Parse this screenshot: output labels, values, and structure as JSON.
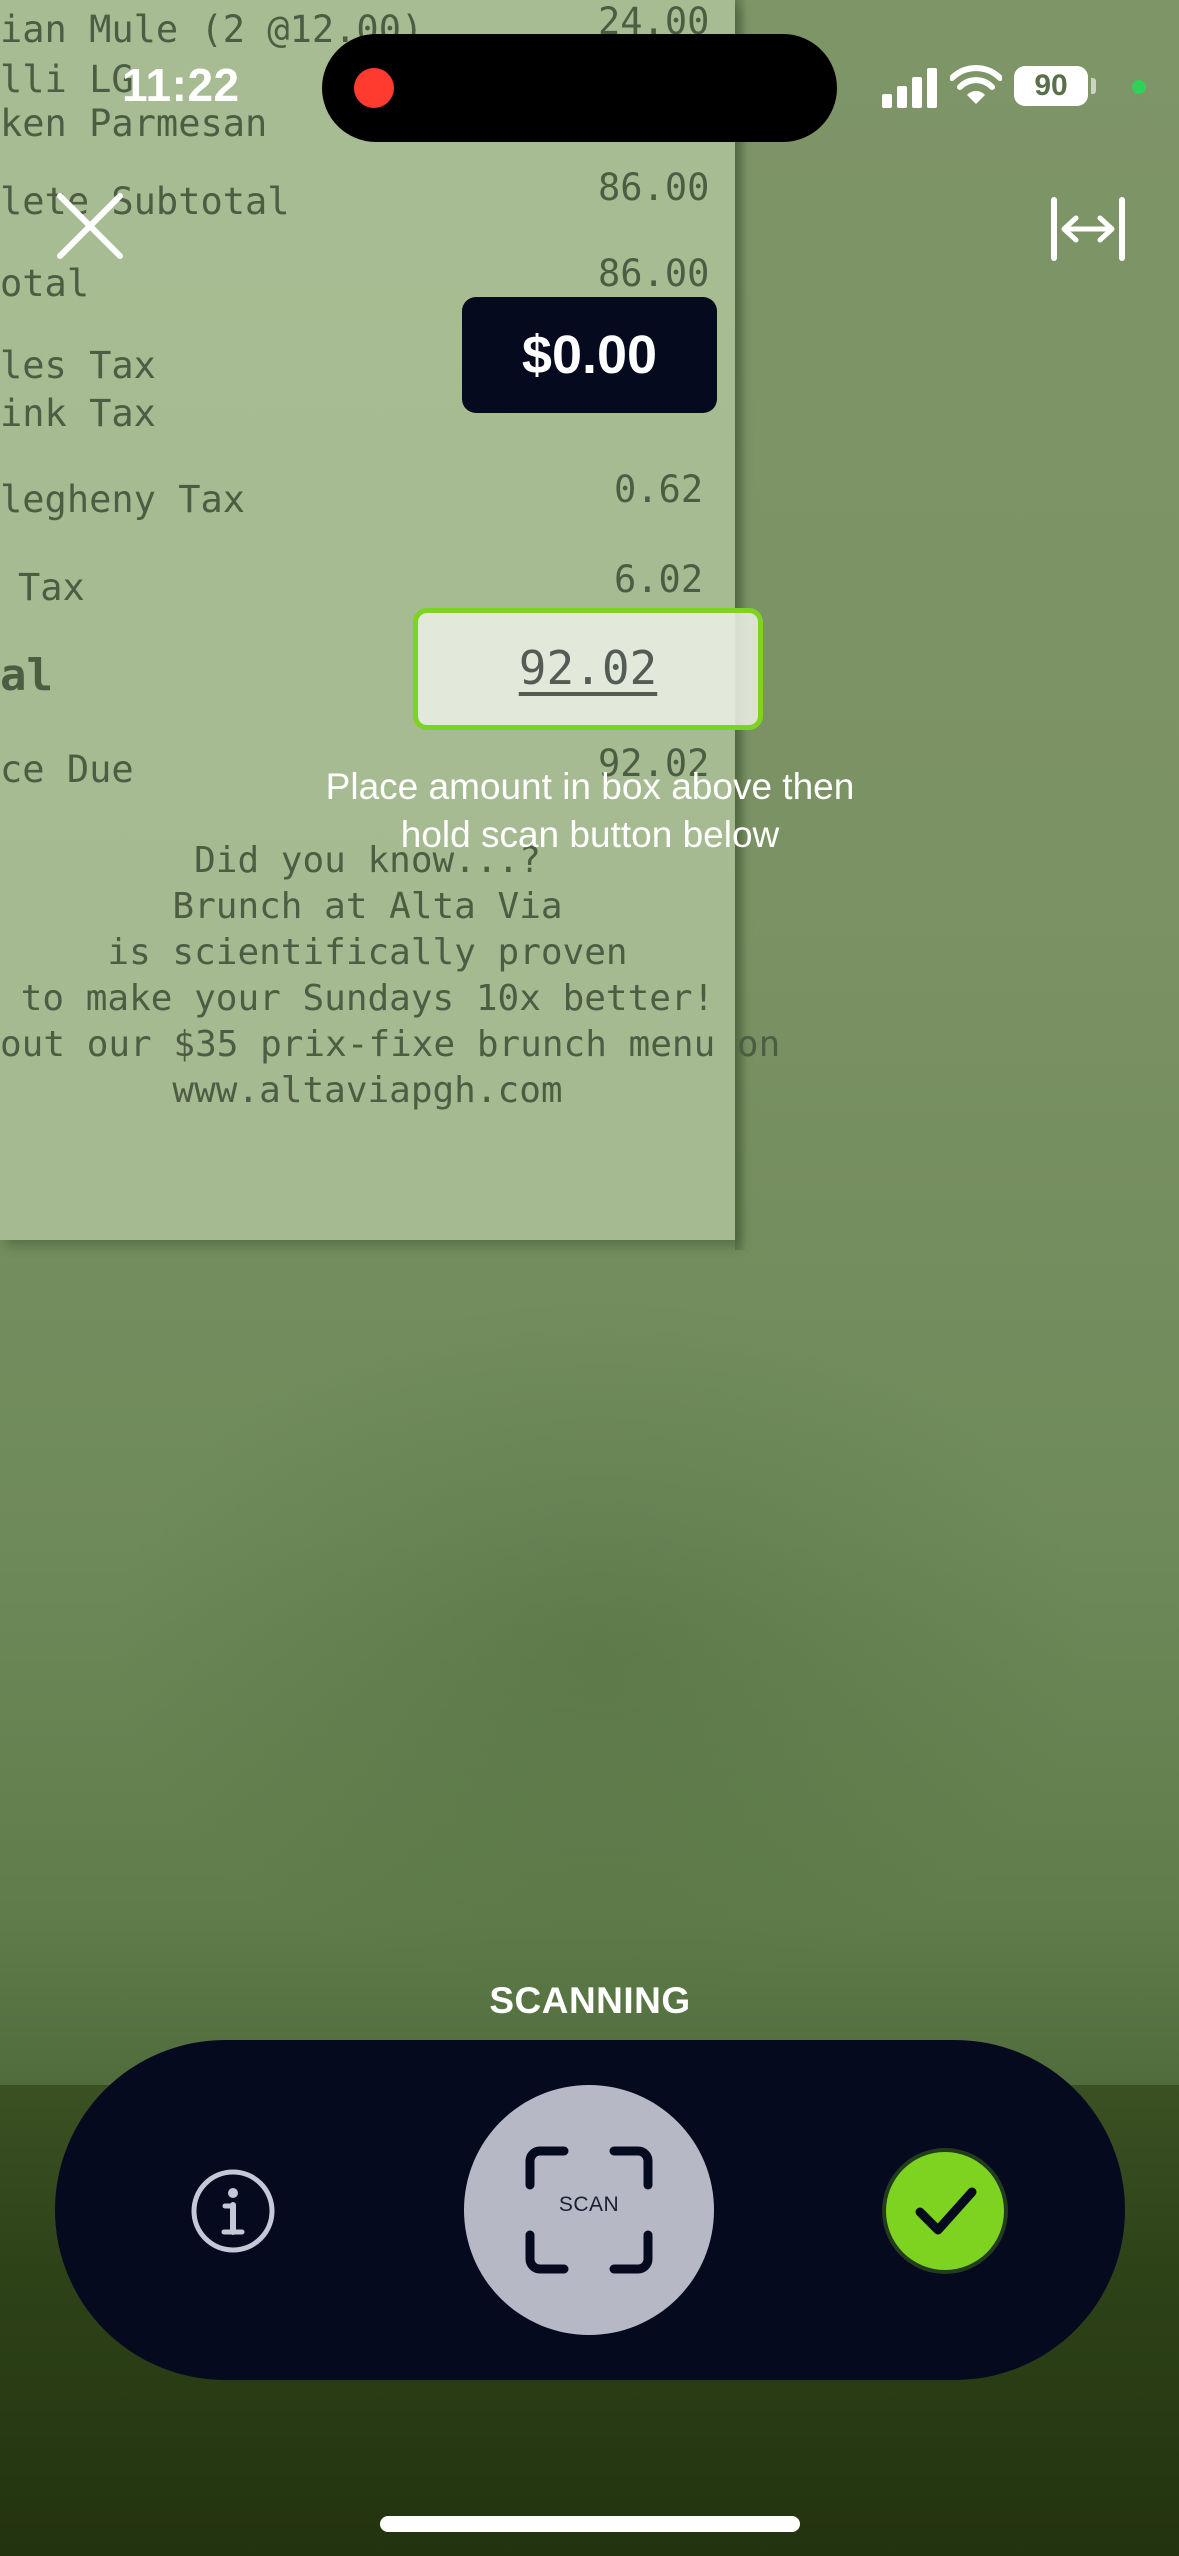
{
  "status_bar": {
    "time": "11:22",
    "battery": "90"
  },
  "receipt": {
    "lines": [
      {
        "left": "ian Mule (2 @12.00)",
        "right": "24.00"
      },
      {
        "left": "lli LG",
        "right": ""
      },
      {
        "left": "ken Parmesan",
        "right": ""
      },
      {
        "left": "lete Subtotal",
        "right": "86.00"
      },
      {
        "left": "otal",
        "right": "86.00"
      },
      {
        "left": "les Tax",
        "right": ""
      },
      {
        "left": "ink Tax",
        "right": ""
      },
      {
        "left": "legheny Tax",
        "right": "0.62"
      },
      {
        "left": "Tax",
        "right": "6.02"
      },
      {
        "left": "al",
        "right": ""
      },
      {
        "left": "ce Due",
        "right": "92.02"
      }
    ],
    "footer": [
      "Did you know...?",
      "Brunch at Alta Via",
      "is scientifically proven",
      "to make your Sundays 10x better!",
      "out our $35 prix-fixe brunch menu on",
      "www.altaviapgh.com"
    ]
  },
  "amount": {
    "total": "$0.00"
  },
  "scan_box": {
    "detected_value": "92.02"
  },
  "hint": {
    "line1": "Place amount in box above then",
    "line2": "hold scan button below"
  },
  "controls": {
    "status_label": "SCANNING",
    "scan_label": "SCAN"
  },
  "icons": {
    "close": "close-icon",
    "width": "expand-width-icon",
    "info": "info-icon",
    "scan": "scan-frame-icon",
    "confirm": "checkmark-icon"
  },
  "colors": {
    "accent": "#7ed321",
    "panel": "#050a1e",
    "scan_button": "#b6b9c5",
    "recording": "#ff3b30"
  }
}
